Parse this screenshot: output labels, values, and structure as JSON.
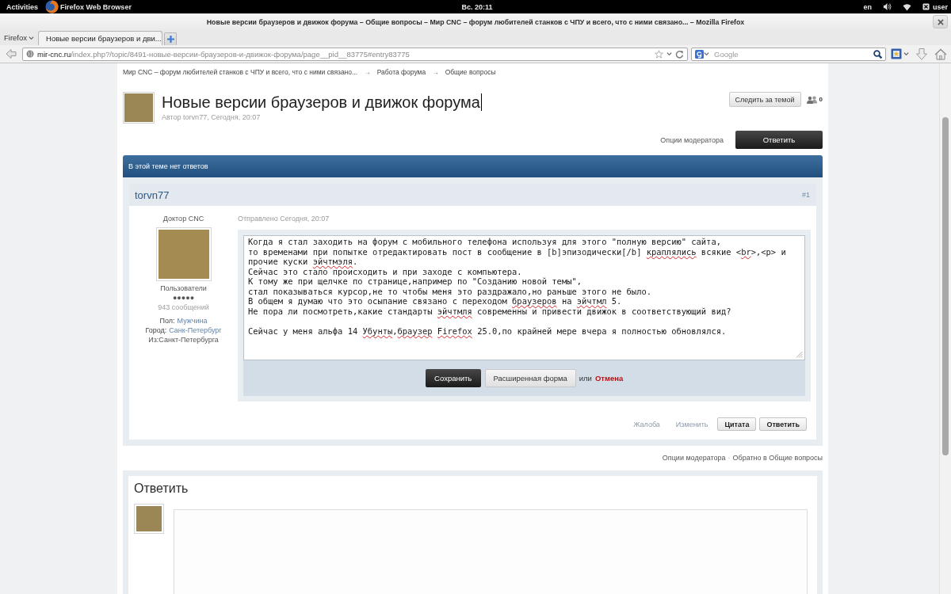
{
  "desktop_bar": {
    "activities": "Activities",
    "app_menu": "Firefox Web Browser",
    "clock": "Вс. 20:11",
    "keyboard_layout": "en",
    "user": "user"
  },
  "window": {
    "title": "Новые версии браузеров и движок форума – Общие вопросы – Мир CNC – форум любителей станков с ЧПУ и всего, что с ними связано... – Mozilla Firefox"
  },
  "menu_button": "Firefox",
  "tabs": [
    {
      "label": "Новые версии браузеров и дви...",
      "selected": true
    }
  ],
  "address_bar": {
    "domain": "mir-cnc.ru",
    "path": "/index.php?/topic/8491-новые-версии-браузеров-и-движок-форума/page__pid__83775#entry83775"
  },
  "search_bar": {
    "placeholder": "Google"
  },
  "page": {
    "breadcrumb": [
      {
        "kind": "link",
        "text": "Мир CNC – форум любителей станков с ЧПУ и всего, что с ними связано..."
      },
      {
        "kind": "separator",
        "text": "→"
      },
      {
        "kind": "link",
        "text": "Работа форума"
      },
      {
        "kind": "separator",
        "text": "→"
      },
      {
        "kind": "link",
        "text": "Общие вопросы"
      }
    ],
    "topic": {
      "title": "Новые версии браузеров и движок форума",
      "byline": "Автор torvn77, Сегодня, 20:07",
      "follow_button": "Следить за темой",
      "follower_count": "0"
    },
    "moderator_options": "Опции модератора",
    "reply_button": "Ответить",
    "notice": "В этой теме нет ответов",
    "post": {
      "author": "torvn77",
      "number": "#1",
      "member_title": "Доктор CNC",
      "group": "Пользователи",
      "rank_pips": "●●●●●",
      "post_count": "943 сообщений",
      "profile_fields": [
        {
          "kind": "field",
          "label": "Пол:",
          "value": "Мужчина"
        },
        {
          "kind": "field",
          "label": "Город:",
          "value": "Санк-Петербург"
        },
        {
          "kind": "note",
          "text": "Из:Санкт-Петербурга"
        }
      ],
      "posted": "Отправлено Сегодня, 20:07",
      "editor": {
        "paragraphs": [
          {
            "lines": [
              {
                "segments": [
                  {
                    "text": "Когда я стал заходить на форум с мобильного телефона используя для этого \"полную версию\" сайта,",
                    "misspelled": false
                  }
                ]
              },
              {
                "segments": [
                  {
                    "text": "то временами при попытке отредактировать пост в сообщение в [b]эпизодически[/b] ",
                    "misspelled": false
                  },
                  {
                    "text": "краплялись",
                    "misspelled": true
                  },
                  {
                    "text": " всякие <",
                    "misspelled": false
                  },
                  {
                    "text": "br",
                    "misspelled": true
                  },
                  {
                    "text": ">,<p> и",
                    "misspelled": false
                  }
                ]
              },
              {
                "segments": [
                  {
                    "text": "прочие куски ",
                    "misspelled": false
                  },
                  {
                    "text": "эйчтмэля",
                    "misspelled": true
                  },
                  {
                    "text": ".",
                    "misspelled": false
                  }
                ]
              },
              {
                "segments": [
                  {
                    "text": "Сейчас это стало происходить и при заходе с компьютера.",
                    "misspelled": false
                  }
                ]
              },
              {
                "segments": [
                  {
                    "text": "К тому же при щелчке по странице,например по \"Созданию новой темы\",",
                    "misspelled": false
                  }
                ]
              },
              {
                "segments": [
                  {
                    "text": "стал показываться курсор,не то чтобы меня это раздражало,но раньше этого не было.",
                    "misspelled": false
                  }
                ]
              },
              {
                "segments": [
                  {
                    "text": "В общем я думаю что это осыпание связано с переходом ",
                    "misspelled": false
                  },
                  {
                    "text": "браузеров",
                    "misspelled": true
                  },
                  {
                    "text": " на ",
                    "misspelled": false
                  },
                  {
                    "text": "эйчтмл",
                    "misspelled": true
                  },
                  {
                    "text": " 5.",
                    "misspelled": false
                  }
                ]
              },
              {
                "segments": [
                  {
                    "text": "Не пора ли посмотреть,какие стандарты ",
                    "misspelled": false
                  },
                  {
                    "text": "эйчтмля",
                    "misspelled": true
                  },
                  {
                    "text": " современны и привести движок в соответствующий вид?",
                    "misspelled": false
                  }
                ]
              }
            ]
          },
          {
            "lines": [
              {
                "segments": [
                  {
                    "text": "Сейчас у меня альфа 14 ",
                    "misspelled": false
                  },
                  {
                    "text": "Убунты",
                    "misspelled": true
                  },
                  {
                    "text": ",",
                    "misspelled": false
                  },
                  {
                    "text": "браузер ",
                    "misspelled": true
                  },
                  {
                    "text": "Firefox",
                    "misspelled": true
                  },
                  {
                    "text": " 25.0,по крайней мере вчера я полностью обновлялся.",
                    "misspelled": false
                  }
                ]
              }
            ]
          }
        ]
      },
      "save_button": "Сохранить",
      "advanced_button": "Расширенная форма",
      "or_text": "или",
      "cancel_link": "Отмена",
      "actions": [
        {
          "kind": "link",
          "label": "Жалоба",
          "disabled": true
        },
        {
          "kind": "link",
          "label": "Изменить",
          "disabled": true
        },
        {
          "kind": "button",
          "label": "Цитата",
          "disabled": false
        },
        {
          "kind": "button",
          "label": "Ответить",
          "disabled": false
        }
      ]
    },
    "footer_links": [
      {
        "kind": "link",
        "text": "Опции модератора"
      },
      {
        "kind": "separator",
        "text": "·"
      },
      {
        "kind": "link",
        "text": "Обратно в Общие вопросы"
      }
    ],
    "reply_form": {
      "heading": "Ответить"
    }
  }
}
